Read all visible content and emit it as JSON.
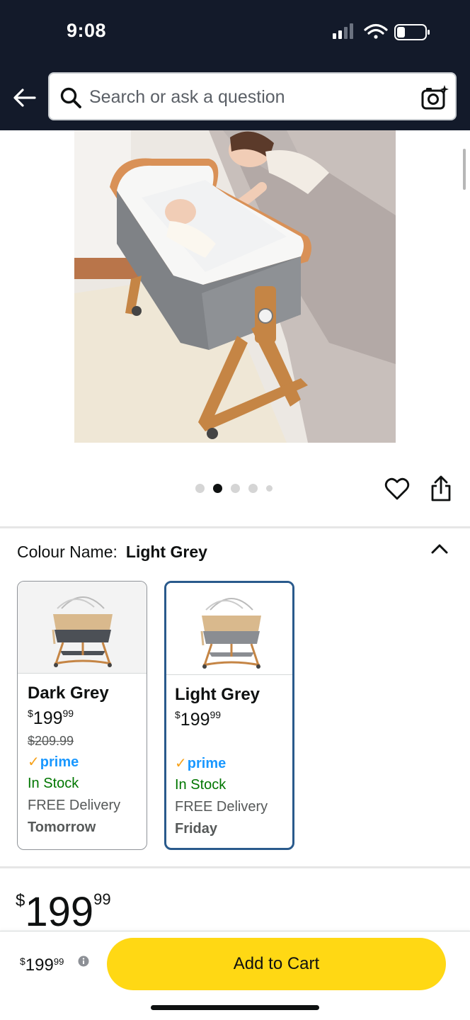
{
  "status_bar": {
    "time": "9:08",
    "icons": [
      "signal-icon",
      "wifi-icon",
      "battery-icon"
    ]
  },
  "header": {
    "back_icon": "back-arrow-icon",
    "search": {
      "placeholder": "Search or ask a question",
      "value": "",
      "icon": "search-icon",
      "camera_icon": "camera-icon"
    }
  },
  "gallery": {
    "image_description_icon": "product-image",
    "total_images": 5,
    "active_index": 1,
    "wishlist_icon": "heart-icon",
    "share_icon": "share-icon"
  },
  "colour": {
    "label": "Colour Name:",
    "selected": "Light Grey",
    "collapse_icon": "chevron-up-icon",
    "options": [
      {
        "name": "Dark Grey",
        "currency": "$",
        "price_whole": "199",
        "price_fraction": "99",
        "old_price": "$209.99",
        "prime": "prime",
        "stock": "In Stock",
        "delivery": "FREE Delivery",
        "delivery_day": "Tomorrow",
        "selected": false
      },
      {
        "name": "Light Grey",
        "currency": "$",
        "price_whole": "199",
        "price_fraction": "99",
        "old_price": "",
        "prime": "prime",
        "stock": "In Stock",
        "delivery": "FREE Delivery",
        "delivery_day": "Friday",
        "selected": true
      }
    ]
  },
  "price": {
    "currency": "$",
    "whole": "199",
    "fraction": "99"
  },
  "bottom_bar": {
    "currency": "$",
    "price_whole": "199",
    "price_fraction": "99",
    "info_icon": "info-icon",
    "add_to_cart_label": "Add to Cart"
  },
  "colors": {
    "header_bg": "#131a2a",
    "accent_button": "#ffd814",
    "selected_border": "#2a5a8c",
    "in_stock": "#007600",
    "prime_blue": "#1a98ff",
    "prime_check": "#f7a21b"
  }
}
